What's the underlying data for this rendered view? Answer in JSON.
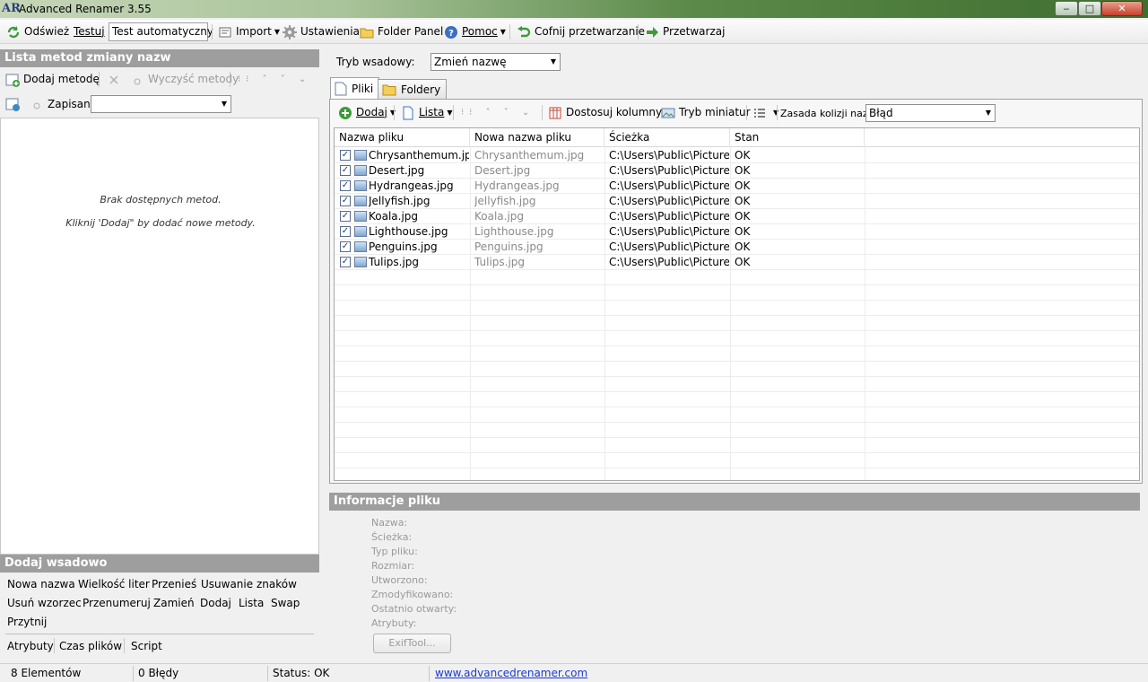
{
  "window": {
    "title": "Advanced Renamer 3.55",
    "app_icon": "AR",
    "controls": {
      "minimize": "‒",
      "maximize": "□",
      "close": "✕"
    }
  },
  "toolbar": {
    "refresh": "Odśwież",
    "test": "Testuj",
    "auto_test": "Test automatyczny",
    "import": "Import",
    "settings": "Ustawienia",
    "folder_panel": "Folder Panel",
    "help": "Pomoc",
    "undo": "Cofnij przetwarzanie",
    "process": "Przetwarzaj"
  },
  "left": {
    "header": "Lista metod zmiany nazw",
    "add_method": "Dodaj metodę",
    "clear_methods": "Wyczyść metody",
    "saved_label": "Zapisane:",
    "saved_value": "",
    "empty_line1": "Brak dostępnych metod.",
    "empty_line2": "Kliknij 'Dodaj\" by dodać nowe metody."
  },
  "batch": {
    "header": "Dodaj wsadowo",
    "row1": [
      "Nowa nazwa",
      "Wielkość liter",
      "Przenieś",
      "Usuwanie znaków"
    ],
    "row2": [
      "Usuń wzorzec",
      "Przenumeruj",
      "Zamień",
      "Dodaj",
      "Lista",
      "Swap"
    ],
    "row3": [
      "Przytnij"
    ],
    "row4": [
      "Atrybuty",
      "Czas plików",
      "Script"
    ]
  },
  "right": {
    "batch_mode_label": "Tryb wsadowy:",
    "batch_mode_value": "Zmień nazwę",
    "tabs": {
      "files": "Pliki",
      "folders": "Foldery"
    },
    "list_toolbar": {
      "add": "Dodaj",
      "list": "Lista",
      "adjust_columns": "Dostosuj kolumny",
      "thumbnail_mode": "Tryb miniatur",
      "collision_label": "Zasada kolizji nazw:",
      "collision_value": "Błąd"
    },
    "columns": [
      "Nazwa pliku",
      "Nowa nazwa pliku",
      "Ścieżka",
      "Stan"
    ],
    "rows": [
      {
        "name": "Chrysanthemum.jpg",
        "new_name": "Chrysanthemum.jpg",
        "path": "C:\\Users\\Public\\Picture…",
        "status": "OK",
        "checked": true
      },
      {
        "name": "Desert.jpg",
        "new_name": "Desert.jpg",
        "path": "C:\\Users\\Public\\Picture…",
        "status": "OK",
        "checked": true
      },
      {
        "name": "Hydrangeas.jpg",
        "new_name": "Hydrangeas.jpg",
        "path": "C:\\Users\\Public\\Picture…",
        "status": "OK",
        "checked": true
      },
      {
        "name": "Jellyfish.jpg",
        "new_name": "Jellyfish.jpg",
        "path": "C:\\Users\\Public\\Picture…",
        "status": "OK",
        "checked": true
      },
      {
        "name": "Koala.jpg",
        "new_name": "Koala.jpg",
        "path": "C:\\Users\\Public\\Picture…",
        "status": "OK",
        "checked": true
      },
      {
        "name": "Lighthouse.jpg",
        "new_name": "Lighthouse.jpg",
        "path": "C:\\Users\\Public\\Picture…",
        "status": "OK",
        "checked": true
      },
      {
        "name": "Penguins.jpg",
        "new_name": "Penguins.jpg",
        "path": "C:\\Users\\Public\\Picture…",
        "status": "OK",
        "checked": true
      },
      {
        "name": "Tulips.jpg",
        "new_name": "Tulips.jpg",
        "path": "C:\\Users\\Public\\Picture…",
        "status": "OK",
        "checked": true
      }
    ]
  },
  "info": {
    "header": "Informacje pliku",
    "labels": [
      "Nazwa:",
      "Ścieżka:",
      "Typ pliku:",
      "Rozmiar:",
      "Utworzono:",
      "Zmodyfikowano:",
      "Ostatnio otwarty:",
      "Atrybuty:"
    ],
    "exif_button": "ExifTool..."
  },
  "status": {
    "elements": "8 Elementów",
    "errors": "0 Błędy",
    "status": "Status: OK",
    "link": "www.advancedrenamer.com"
  },
  "colors": {
    "section_header": "#9e9e9e",
    "title_gradient_end": "#3e6e30",
    "link": "#1a3ad0",
    "icon_green": "#3f9a3a",
    "icon_blue": "#3a6fc4"
  },
  "icons": [
    "refresh-icon",
    "import-icon",
    "gear-icon",
    "folder-icon",
    "help-icon",
    "undo-icon",
    "arrow-right-icon",
    "add-icon",
    "clear-icon",
    "file-icon",
    "checkbox-icon"
  ]
}
